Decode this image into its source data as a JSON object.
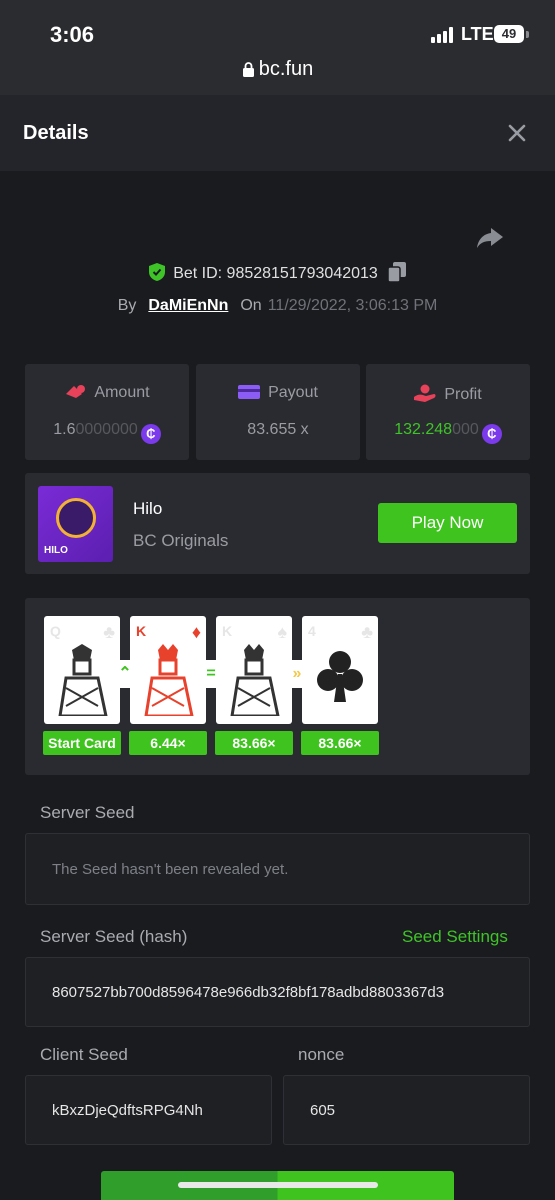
{
  "status_bar": {
    "time": "3:06",
    "network": "LTE",
    "battery": "49"
  },
  "browser": {
    "url": "bc.fun"
  },
  "header": {
    "title": "Details"
  },
  "bet": {
    "bet_id": "Bet ID: 98528151793042013",
    "by_label": "By",
    "username": "DaMiEnNn",
    "on_label": "On",
    "datetime": "11/29/2022, 3:06:13 PM"
  },
  "stats": {
    "amount_label": "Amount",
    "amount_value": "1.6",
    "amount_value_dim": "0000000",
    "payout_label": "Payout",
    "payout_value": "83.655 x",
    "profit_label": "Profit",
    "profit_value": "132.248",
    "profit_value_dim": "000",
    "currency_symbol": "₵"
  },
  "game": {
    "thumb_text": "HILO",
    "name": "Hilo",
    "provider": "BC Originals",
    "play_label": "Play Now"
  },
  "cards": [
    {
      "rank": "Q",
      "suit": "♣",
      "color": "#222222",
      "multiplier": "Start Card"
    },
    {
      "rank": "K",
      "suit": "♦",
      "color": "#e8412c",
      "multiplier": "6.44×"
    },
    {
      "rank": "K",
      "suit": "♠",
      "color": "#222222",
      "multiplier": "83.66×"
    },
    {
      "rank": "4",
      "suit": "♣",
      "color": "#222222",
      "multiplier": "83.66×"
    }
  ],
  "connectors": [
    {
      "symbol": "⌃",
      "color": "#3fc41f"
    },
    {
      "symbol": "=",
      "color": "#3fc41f"
    },
    {
      "symbol": "»",
      "color": "#f2c94c"
    }
  ],
  "seeds": {
    "server_seed_label": "Server Seed",
    "server_seed_value": "The Seed hasn't been revealed yet.",
    "server_hash_label": "Server Seed (hash)",
    "seed_settings_label": "Seed Settings",
    "server_hash_value": "8607527bb700d8596478e966db32f8bf178adbd8803367d3",
    "client_seed_label": "Client Seed",
    "client_seed_value": "kBxzDjeQdftsRPG4Nh",
    "nonce_label": "nonce",
    "nonce_value": "605"
  }
}
